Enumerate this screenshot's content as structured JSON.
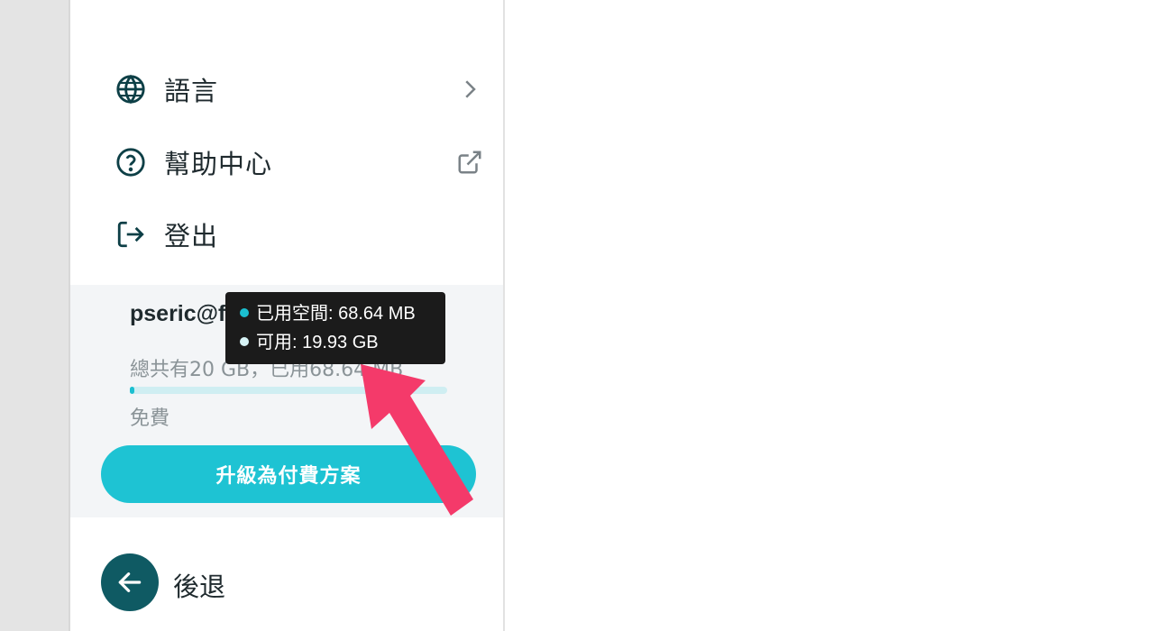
{
  "menu": {
    "items": [
      {
        "label": "語言",
        "icon": "globe-icon",
        "trailing": "chevron-right-icon"
      },
      {
        "label": "幫助中心",
        "icon": "help-circle-icon",
        "trailing": "external-link-icon"
      },
      {
        "label": "登出",
        "icon": "logout-icon"
      }
    ]
  },
  "account": {
    "email": "pseric@fr",
    "usage_text": "總共有20 GB，已用68.64 MB",
    "usage_fraction": 0.0034,
    "plan": "免費",
    "upgrade_label": "升級為付費方案"
  },
  "tooltip": {
    "used": "已用空間: 68.64 MB",
    "free": "可用: 19.93 GB",
    "used_color": "#1bbfd0",
    "free_color": "#d7f3f6"
  },
  "back": {
    "label": "後退"
  },
  "colors": {
    "accent": "#1ec3d3",
    "back_button": "#0f5a63",
    "annotation_arrow": "#f43a6a"
  }
}
